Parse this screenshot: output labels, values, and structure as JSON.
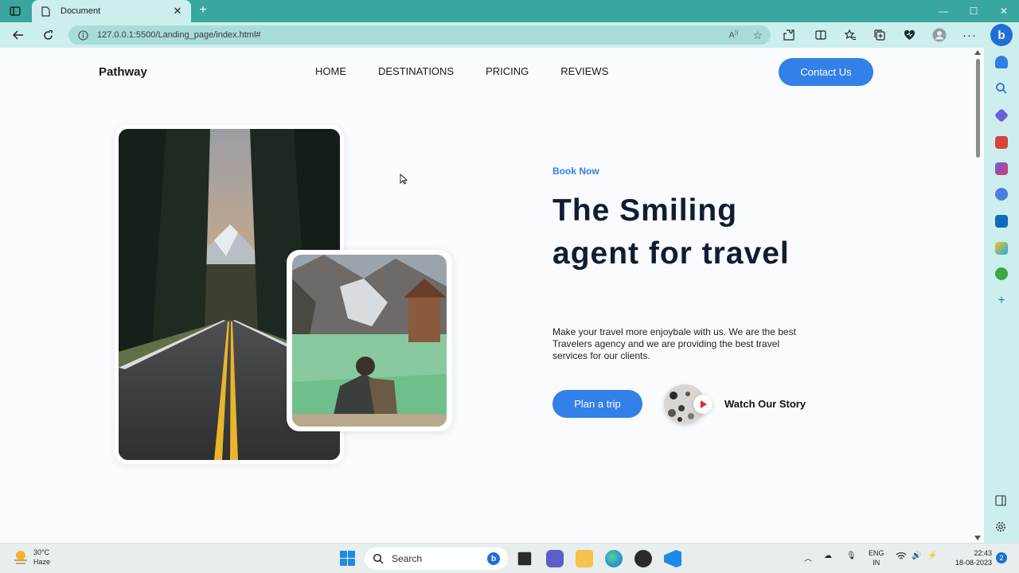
{
  "browser": {
    "tab_title": "Document",
    "tab_close": "✕",
    "new_tab": "+",
    "url": "127.0.0.1:5500/Landing_page/index.html#",
    "window_controls": {
      "minimize": "—",
      "maximize": "☐",
      "close": "✕"
    }
  },
  "nav": {
    "brand": "Pathway",
    "links": [
      "HOME",
      "DESTINATIONS",
      "PRICING",
      "REVIEWS"
    ],
    "contact": "Contact Us"
  },
  "hero": {
    "kicker": "Book Now",
    "title": "The Smiling agent for travel",
    "description": "Make your travel more enjoybale with us. We are the best Travelers agency and we are providing the best travel services for our clients.",
    "plan_button": "Plan a trip",
    "watch_label": "Watch Our Story"
  },
  "colors": {
    "accent": "#3280e8",
    "heading": "#111c33",
    "chrome": "#3aa6a0",
    "play": "#e52521"
  },
  "taskbar": {
    "weather_temp": "30°C",
    "weather_desc": "Haze",
    "search_label": "Search",
    "lang_1": "ENG",
    "lang_2": "IN",
    "time": "22:43",
    "date": "18-08-2023",
    "notifications": "2"
  }
}
